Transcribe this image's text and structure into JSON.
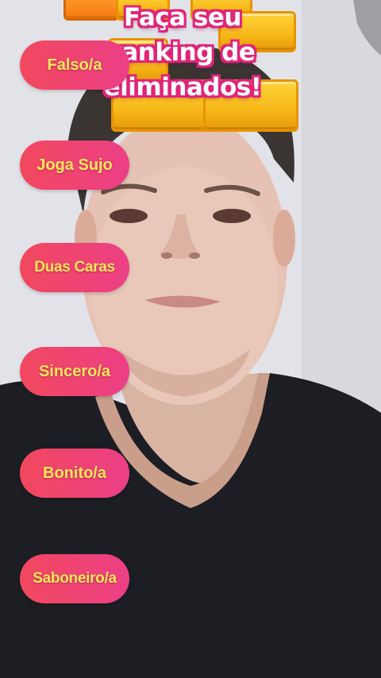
{
  "filter": {
    "title": "Faça seu\nranking de\neliminados!"
  },
  "categories": [
    {
      "label": "Falso/a"
    },
    {
      "label": "Joga Sujo"
    },
    {
      "label": "Duas Caras"
    },
    {
      "label": "Sincero/a"
    },
    {
      "label": "Bonito/a"
    },
    {
      "label": "Saboneiro/a"
    }
  ],
  "colors": {
    "pill_gradient_start": "#f2485e",
    "pill_gradient_end": "#ec3f86",
    "pill_text": "#ffe85a",
    "title_outline": "#e0247a",
    "block_yellow": "#f7b718",
    "block_orange": "#f57c10"
  }
}
